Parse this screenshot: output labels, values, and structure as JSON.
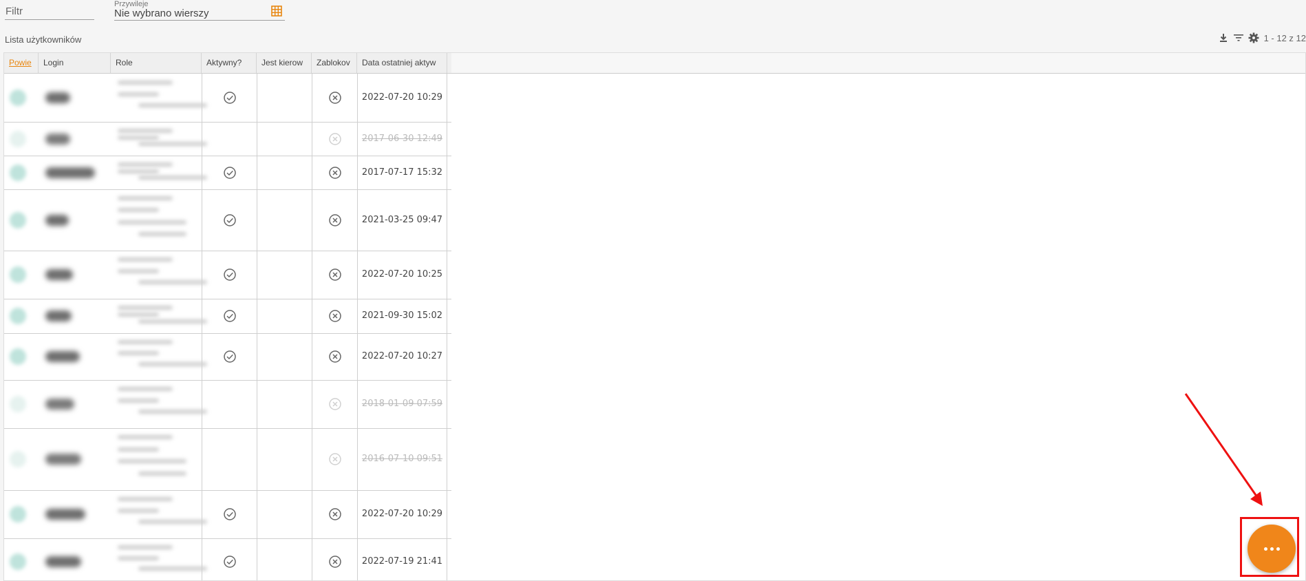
{
  "filter": {
    "placeholder": "Filtr"
  },
  "privileges": {
    "label": "Przywileje",
    "value": "Nie wybrano wierszy"
  },
  "list": {
    "title": "Lista użytkowników",
    "pager": "1 - 12 z 12"
  },
  "toolbar": {
    "icons": [
      "download-icon",
      "filter-icon",
      "gear-icon"
    ]
  },
  "columns": [
    "Powie",
    "Login",
    "Role",
    "Aktywny?",
    "Jest kierow",
    "Zablokov",
    "Data ostatniej aktyw"
  ],
  "rows": [
    {
      "active": true,
      "date": "2022-07-20 10:29"
    },
    {
      "active": false,
      "date": "2017-06-30 12:49"
    },
    {
      "active": true,
      "date": "2017-07-17 15:32"
    },
    {
      "active": true,
      "date": "2021-03-25 09:47"
    },
    {
      "active": true,
      "date": "2022-07-20 10:25"
    },
    {
      "active": true,
      "date": "2021-09-30 15:02"
    },
    {
      "active": true,
      "date": "2022-07-20 10:27"
    },
    {
      "active": false,
      "date": "2018-01-09 07:59"
    },
    {
      "active": false,
      "date": "2016-07-10 09:51"
    },
    {
      "active": true,
      "date": "2022-07-20 10:29"
    },
    {
      "active": true,
      "date": "2022-07-19 21:41"
    }
  ],
  "fab": {
    "icon": "more-horizontal-icon",
    "color": "#f0861a"
  },
  "colors": {
    "accent": "#e8860f",
    "annotation": "#e11111"
  }
}
